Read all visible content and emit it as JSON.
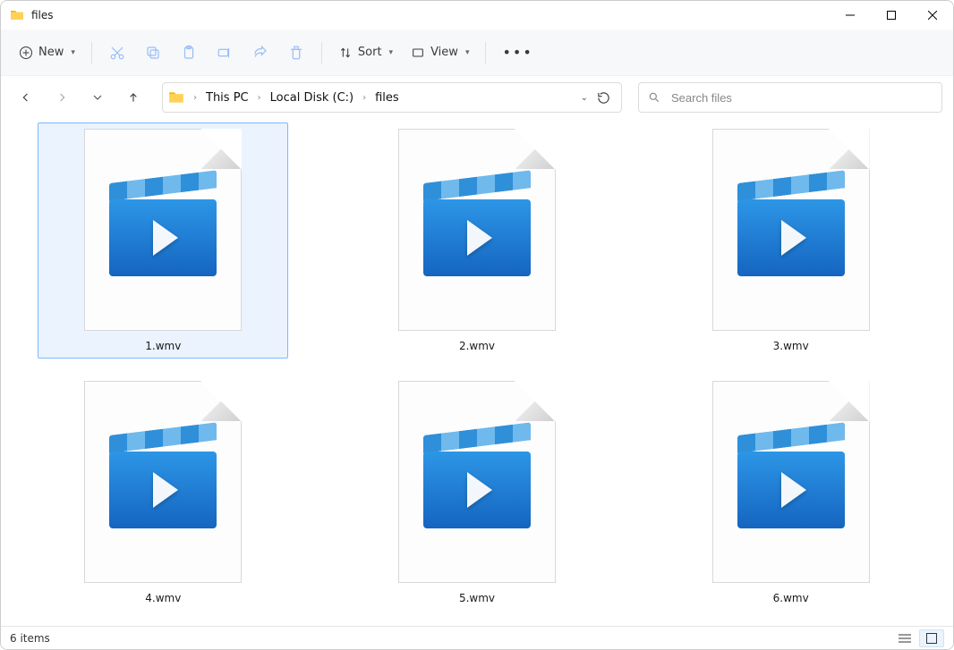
{
  "window_title": "files",
  "toolbar": {
    "new_label": "New",
    "sort_label": "Sort",
    "view_label": "View"
  },
  "breadcrumbs": [
    "This PC",
    "Local Disk (C:)",
    "files"
  ],
  "search_placeholder": "Search files",
  "files": [
    {
      "name": "1.wmv",
      "selected": true
    },
    {
      "name": "2.wmv",
      "selected": false
    },
    {
      "name": "3.wmv",
      "selected": false
    },
    {
      "name": "4.wmv",
      "selected": false
    },
    {
      "name": "5.wmv",
      "selected": false
    },
    {
      "name": "6.wmv",
      "selected": false
    }
  ],
  "status_text": "6 items"
}
